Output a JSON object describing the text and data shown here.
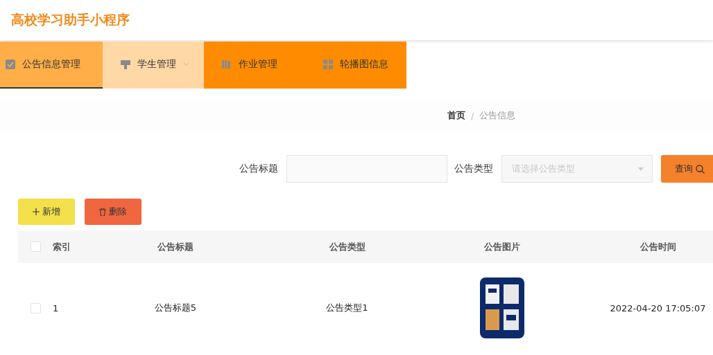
{
  "app_title": "高校学习助手小程序",
  "nav": [
    {
      "label": "公告信息管理",
      "kind": "check",
      "selected": true,
      "hovered": false,
      "has_submenu": false
    },
    {
      "label": "学生管理",
      "kind": "person",
      "selected": false,
      "hovered": true,
      "has_submenu": true
    },
    {
      "label": "作业管理",
      "kind": "book",
      "selected": false,
      "hovered": false,
      "has_submenu": false
    },
    {
      "label": "轮播图信息",
      "kind": "grid",
      "selected": false,
      "hovered": false,
      "has_submenu": false
    }
  ],
  "breadcrumb": [
    "首页",
    "公告信息"
  ],
  "breadcrumb_separator": "/",
  "search": {
    "title_label": "公告标题",
    "type_label": "公告类型",
    "type_placeholder": "请选择公告类型",
    "query_button": "查询"
  },
  "actions": [
    {
      "kind": "add",
      "label": "新增"
    },
    {
      "kind": "delete",
      "label": "删除"
    }
  ],
  "table": {
    "all_checked": false,
    "columns": [
      "索引",
      "公告标题",
      "公告类型",
      "公告图片",
      "公告时间"
    ],
    "rows": [
      {
        "checked": false,
        "cells": [
          "1",
          "公告标题5",
          "公告类型1",
          {
            "kind": "picture"
          },
          "2022-04-20 17:05:07"
        ]
      }
    ]
  }
}
